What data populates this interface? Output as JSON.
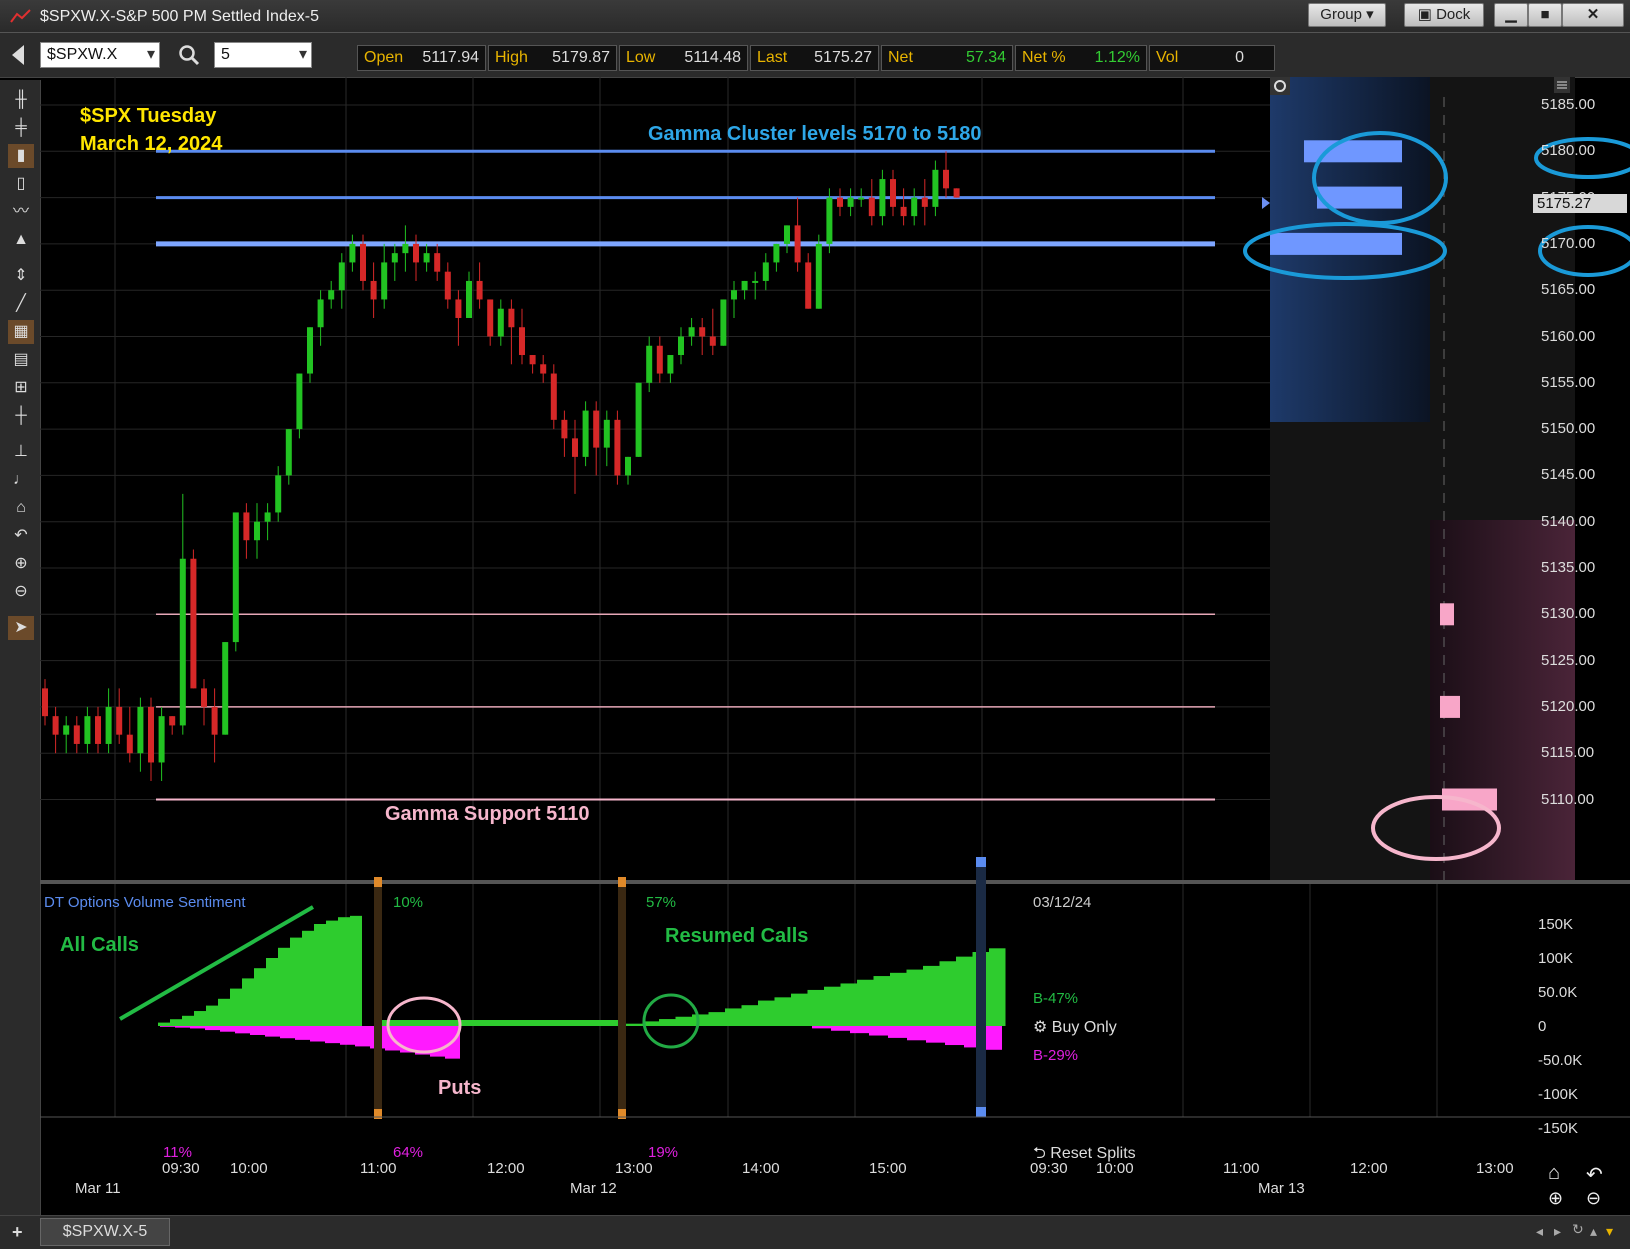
{
  "window": {
    "title": "$SPXW.X-S&P 500 PM Settled Index-5",
    "group_label": "Group",
    "dock_label": "Dock",
    "min_icon": "minimize-icon",
    "max_icon": "maximize-icon",
    "close_icon": "close-icon"
  },
  "toolbar": {
    "symbol": "$SPXW.X",
    "interval": "5",
    "quote": [
      {
        "label": "Open",
        "value": "5117.94"
      },
      {
        "label": "High",
        "value": "5179.87"
      },
      {
        "label": "Low",
        "value": "5114.48"
      },
      {
        "label": "Last",
        "value": "5175.27"
      },
      {
        "label": "Net",
        "value": "57.34"
      },
      {
        "label": "Net %",
        "value": "1.12%"
      },
      {
        "label": "Vol",
        "value": "0"
      }
    ],
    "colors": {
      "positive": "#33cc33",
      "label": "#e8b400"
    }
  },
  "annotations": {
    "title_line1": "$SPX Tuesday",
    "title_line2": "March 12, 2024",
    "gamma_cluster": "Gamma Cluster levels 5170 to 5180",
    "gamma_support": "Gamma Support 5110",
    "all_calls": "All Calls",
    "puts": "Puts",
    "resumed_calls": "Resumed Calls"
  },
  "price_axis": {
    "labels": [
      "5185.00",
      "5180.00",
      "5175.00",
      "5170.00",
      "5165.00",
      "5160.00",
      "5155.00",
      "5150.00",
      "5145.00",
      "5140.00",
      "5135.00",
      "5130.00",
      "5125.00",
      "5120.00",
      "5115.00",
      "5110.00"
    ],
    "last_label": "5175.27"
  },
  "volume_panel": {
    "title": "DT Options Volume Sentiment",
    "axis_labels": [
      "150K",
      "100K",
      "50.0K",
      "0",
      "-50.0K",
      "-100K",
      "-150K"
    ],
    "pct_top_1": "10%",
    "pct_top_2": "57%",
    "pct_bot_0": "11%",
    "pct_bot_1": "64%",
    "pct_bot_2": "19%",
    "date": "03/12/24",
    "b_calls": "B-47%",
    "b_puts": "B-29%",
    "buy_only": "Buy Only",
    "reset_splits": "Reset Splits"
  },
  "time_axis": {
    "times": [
      "09:30",
      "10:00",
      "11:00",
      "12:00",
      "13:00",
      "14:00",
      "15:00",
      "09:30",
      "10:00",
      "11:00",
      "12:00",
      "13:00"
    ],
    "dates": [
      "Mar 11",
      "Mar 12",
      "Mar 13"
    ]
  },
  "status": {
    "tab": "$SPXW.X-5",
    "add": "+"
  },
  "chart_data": {
    "type": "candlestick",
    "y_range": [
      5105,
      5188
    ],
    "horizontal_levels": [
      5180,
      5175,
      5170,
      5130,
      5120,
      5110
    ],
    "candles": [
      [
        5122,
        5123,
        5118,
        5119
      ],
      [
        5119,
        5120,
        5115,
        5117
      ],
      [
        5117,
        5119,
        5115,
        5118
      ],
      [
        5118,
        5119,
        5115,
        5116
      ],
      [
        5116,
        5120,
        5115,
        5119
      ],
      [
        5119,
        5120,
        5115,
        5116
      ],
      [
        5116,
        5122,
        5115,
        5120
      ],
      [
        5120,
        5122,
        5116,
        5117
      ],
      [
        5117,
        5120,
        5114,
        5115
      ],
      [
        5115,
        5121,
        5113,
        5120
      ],
      [
        5120,
        5121,
        5112,
        5114
      ],
      [
        5114,
        5120,
        5112,
        5119
      ],
      [
        5119,
        5119,
        5117,
        5118
      ],
      [
        5118,
        5143,
        5117,
        5136
      ],
      [
        5136,
        5137,
        5122,
        5122
      ],
      [
        5122,
        5123,
        5118,
        5120
      ],
      [
        5120,
        5122,
        5114,
        5117
      ],
      [
        5117,
        5127,
        5117,
        5127
      ],
      [
        5127,
        5141,
        5126,
        5141
      ],
      [
        5141,
        5142,
        5136,
        5138
      ],
      [
        5138,
        5142,
        5136,
        5140
      ],
      [
        5140,
        5142,
        5138,
        5141
      ],
      [
        5141,
        5146,
        5140,
        5145
      ],
      [
        5145,
        5150,
        5144,
        5150
      ],
      [
        5150,
        5156,
        5149,
        5156
      ],
      [
        5156,
        5161,
        5155,
        5161
      ],
      [
        5161,
        5165,
        5159,
        5164
      ],
      [
        5164,
        5166,
        5163,
        5165
      ],
      [
        5165,
        5169,
        5163,
        5168
      ],
      [
        5168,
        5171,
        5167,
        5170
      ],
      [
        5170,
        5171,
        5165,
        5166
      ],
      [
        5166,
        5168,
        5162,
        5164
      ],
      [
        5164,
        5170,
        5163,
        5168
      ],
      [
        5168,
        5170,
        5166,
        5169
      ],
      [
        5169,
        5172,
        5167,
        5170
      ],
      [
        5170,
        5171,
        5166,
        5168
      ],
      [
        5168,
        5170,
        5167,
        5169
      ],
      [
        5169,
        5170,
        5166,
        5167
      ],
      [
        5167,
        5168,
        5163,
        5164
      ],
      [
        5164,
        5165,
        5159,
        5162
      ],
      [
        5162,
        5167,
        5162,
        5166
      ],
      [
        5166,
        5168,
        5163,
        5164
      ],
      [
        5164,
        5164,
        5159,
        5160
      ],
      [
        5160,
        5164,
        5159,
        5163
      ],
      [
        5163,
        5164,
        5157,
        5161
      ],
      [
        5161,
        5163,
        5157,
        5158
      ],
      [
        5158,
        5158,
        5156,
        5157
      ],
      [
        5157,
        5158,
        5155,
        5156
      ],
      [
        5156,
        5157,
        5150,
        5151
      ],
      [
        5151,
        5152,
        5147,
        5149
      ],
      [
        5149,
        5151,
        5143,
        5147
      ],
      [
        5147,
        5153,
        5146,
        5152
      ],
      [
        5152,
        5153,
        5145,
        5148
      ],
      [
        5148,
        5152,
        5146,
        5151
      ],
      [
        5151,
        5152,
        5144,
        5145
      ],
      [
        5145,
        5147,
        5144,
        5147
      ],
      [
        5147,
        5155,
        5147,
        5155
      ],
      [
        5155,
        5160,
        5154,
        5159
      ],
      [
        5159,
        5160,
        5155,
        5156
      ],
      [
        5156,
        5158,
        5155,
        5158
      ],
      [
        5158,
        5161,
        5157,
        5160
      ],
      [
        5160,
        5162,
        5159,
        5161
      ],
      [
        5161,
        5162,
        5158,
        5160
      ],
      [
        5160,
        5163,
        5158,
        5159
      ],
      [
        5159,
        5164,
        5159,
        5164
      ],
      [
        5164,
        5166,
        5162,
        5165
      ],
      [
        5165,
        5166,
        5164,
        5166
      ],
      [
        5166,
        5167,
        5164,
        5166
      ],
      [
        5166,
        5169,
        5165,
        5168
      ],
      [
        5168,
        5170,
        5167,
        5170
      ],
      [
        5170,
        5172,
        5169,
        5172
      ],
      [
        5172,
        5175,
        5167,
        5168
      ],
      [
        5168,
        5169,
        5163,
        5163
      ],
      [
        5163,
        5171,
        5163,
        5170
      ],
      [
        5170,
        5176,
        5169,
        5175
      ],
      [
        5175,
        5176,
        5173,
        5174
      ],
      [
        5174,
        5176,
        5173,
        5175
      ],
      [
        5175,
        5176,
        5174,
        5175
      ],
      [
        5175,
        5177,
        5172,
        5173
      ],
      [
        5173,
        5178,
        5172,
        5177
      ],
      [
        5177,
        5178,
        5173,
        5174
      ],
      [
        5174,
        5176,
        5172,
        5173
      ],
      [
        5173,
        5176,
        5172,
        5175
      ],
      [
        5175,
        5177,
        5172,
        5174
      ],
      [
        5174,
        5179,
        5173,
        5178
      ],
      [
        5178,
        5180,
        5175,
        5176
      ],
      [
        5176,
        5176,
        5175,
        5175
      ]
    ],
    "volume_calls_k": [
      5,
      10,
      15,
      22,
      30,
      40,
      55,
      70,
      85,
      100,
      115,
      130,
      140,
      150,
      155,
      160,
      162
    ],
    "volume_puts_k": [
      -2,
      -4,
      -6,
      -10,
      -14,
      -18,
      -22,
      -26,
      -30,
      -34,
      -38,
      -42,
      -46,
      -50,
      -55,
      -60,
      -65,
      -70,
      -75,
      -80
    ],
    "resumed_calls_k": [
      5,
      10,
      15,
      20,
      25,
      30,
      38,
      45,
      55,
      62,
      70,
      78,
      85,
      92,
      100,
      108,
      115,
      122,
      130,
      140,
      150,
      160,
      168
    ],
    "resumed_puts_k": [
      -5,
      -10,
      -15,
      -20,
      -25,
      -30,
      -35,
      -40,
      -45,
      -50
    ]
  }
}
